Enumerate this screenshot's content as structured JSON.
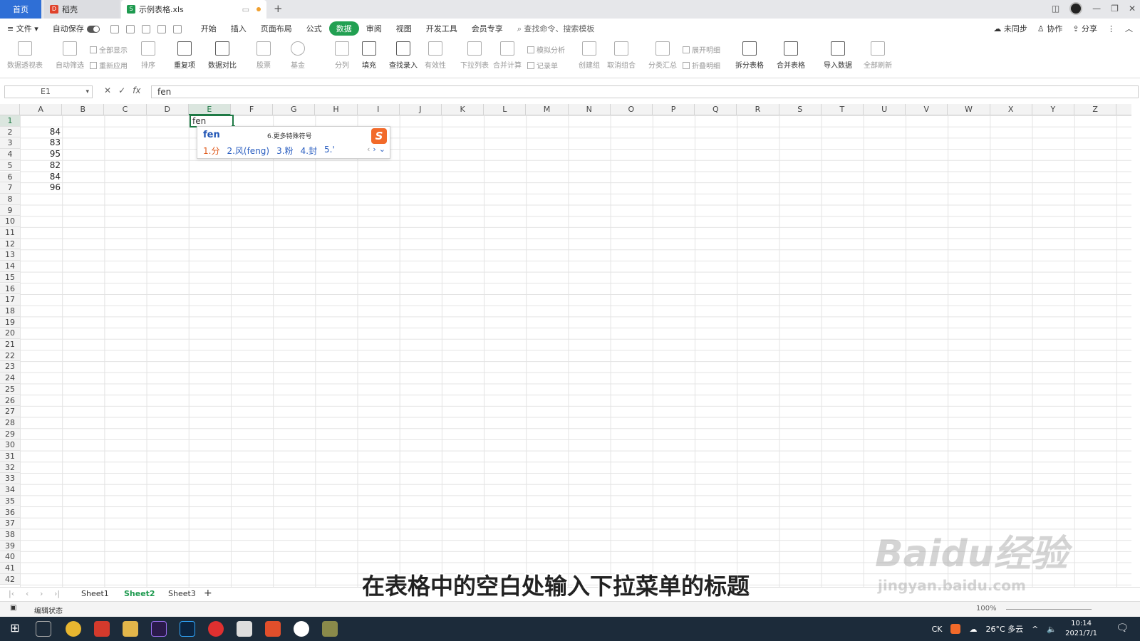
{
  "titlebar": {
    "tabs": [
      "首页",
      "稻壳",
      "示例表格.xls"
    ]
  },
  "menubar": {
    "file": "文件",
    "autosave": "自动保存",
    "items": [
      "开始",
      "插入",
      "页面布局",
      "公式",
      "数据",
      "审阅",
      "视图",
      "开发工具",
      "会员专享"
    ],
    "active": "数据",
    "search_placeholder": "查找命令、搜索模板",
    "right": [
      "未同步",
      "协作",
      "分享"
    ]
  },
  "ribbon": {
    "buttons": [
      "数据透视表",
      "自动筛选",
      "排序",
      "重复项",
      "数据对比",
      "股票",
      "基金",
      "分列",
      "填充",
      "查找录入",
      "有效性",
      "下拉列表",
      "合并计算",
      "创建组",
      "取消组合",
      "分类汇总",
      "拆分表格",
      "合并表格",
      "导入数据",
      "全部刷新"
    ],
    "small_buttons": [
      "全部显示",
      "重新应用",
      "模拟分析",
      "记录单",
      "展开明细",
      "折叠明细"
    ]
  },
  "formula_bar": {
    "name_box": "E1",
    "formula": "fen"
  },
  "grid": {
    "columns": [
      "A",
      "B",
      "C",
      "D",
      "E",
      "F",
      "G",
      "H",
      "I",
      "J",
      "K",
      "L",
      "M",
      "N",
      "O",
      "P",
      "Q",
      "R",
      "S",
      "T",
      "U",
      "V",
      "W",
      "X",
      "Y",
      "Z"
    ],
    "row_count": 42,
    "column_a_values": [
      "84",
      "83",
      "95",
      "82",
      "84",
      "96"
    ],
    "active_cell_value": "fen"
  },
  "ime": {
    "input": "fen",
    "special": "6.更多特殊符号",
    "candidates": [
      "1.分",
      "2.风(feng)",
      "3.粉",
      "4.封",
      "5.'"
    ]
  },
  "sheets": {
    "tabs": [
      "Sheet1",
      "Sheet2",
      "Sheet3"
    ],
    "active": "Sheet2"
  },
  "statusbar": {
    "text": "编辑状态",
    "zoom": "100%"
  },
  "taskbar": {
    "weather": "26°C 多云",
    "time": "10:14",
    "date": "2021/7/1",
    "lang": "CK"
  },
  "overlay": {
    "subtitle": "在表格中的空白处输入下拉菜单的标题",
    "watermark": "Baidu经验",
    "watermark_url": "jingyan.baidu.com"
  },
  "colors": {
    "accent": "#1e7a45",
    "data_tab": "#22a052",
    "home_tab": "#2f6fd6",
    "ime_brand": "#f26a2a"
  }
}
